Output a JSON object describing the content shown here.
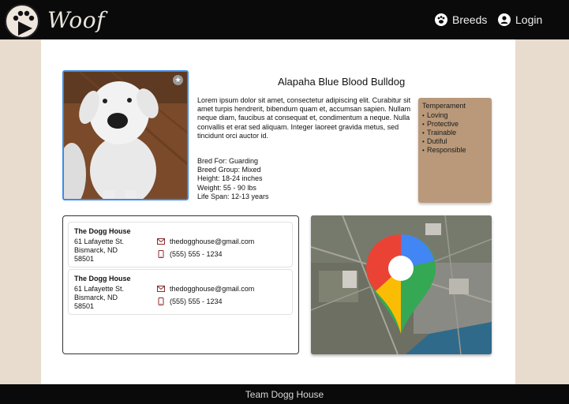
{
  "nav": {
    "brand": "Woof",
    "breeds_label": "Breeds",
    "login_label": "Login"
  },
  "breed": {
    "name": "Alapaha Blue Blood Bulldog",
    "description": "Lorem ipsum dolor sit amet, consectetur adipiscing elit. Curabitur sit amet turpis hendrerit, bibendum quam et, accumsan sapien. Nullam neque diam, faucibus at consequat et, condimentum a neque. Nulla convallis et erat sed aliquam. Integer laoreet gravida metus, sed tincidunt orci auctor id.",
    "facts": {
      "bred_for": "Bred For: Guarding",
      "breed_group": "Breed Group: Mixed",
      "height": "Height: 18-24 inches",
      "weight": "Weight: 55 - 90 lbs",
      "life_span": "Life Span: 12-13 years"
    },
    "temperament_title": "Temperament",
    "temperament": [
      "Loving",
      "Protective",
      "Trainable",
      "Dutiful",
      "Responsible"
    ]
  },
  "contacts": [
    {
      "name": "The Dogg House",
      "address_line1": "61 Lafayette St.",
      "address_line2": "Bismarck, ND",
      "address_line3": "58501",
      "email": "thedogghouse@gmail.com",
      "phone": "(555) 555 - 1234"
    },
    {
      "name": "The Dogg House",
      "address_line1": "61 Lafayette St.",
      "address_line2": "Bismarck, ND",
      "address_line3": "58501",
      "email": "thedogghouse@gmail.com",
      "phone": "(555) 555 - 1234"
    }
  ],
  "footer": {
    "text": "Team Dogg House"
  },
  "colors": {
    "navbar_bg": "#0a0a0a",
    "page_bg": "#e8dccf",
    "photo_border": "#3c8ce6",
    "temperament_bg": "#b9997a",
    "contact_icon": "#8b2a2a"
  },
  "icons": {
    "logo": "paw-play-icon",
    "breeds": "paw-icon",
    "login": "user-icon",
    "favorite": "star-icon",
    "email": "mail-icon",
    "phone": "phone-icon",
    "map_pin": "google-maps-pin-icon"
  }
}
